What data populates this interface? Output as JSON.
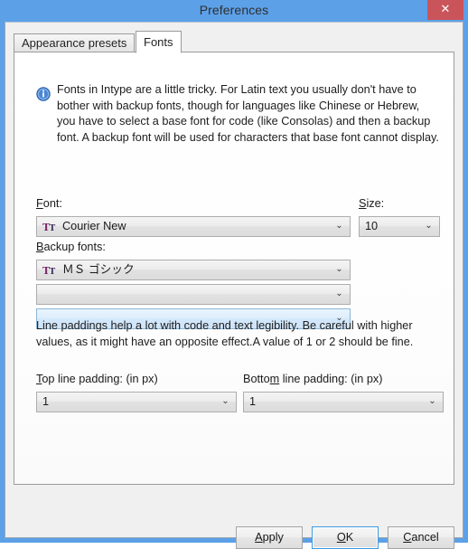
{
  "window": {
    "title": "Preferences",
    "close_label": "✕",
    "accent_color": "#5ca0e8",
    "close_color": "#c9555a"
  },
  "tabs": [
    {
      "label": "Appearance presets",
      "active": false
    },
    {
      "label": "Fonts",
      "active": true
    }
  ],
  "info": {
    "icon": "info-icon",
    "text": "Fonts in Intype are a little tricky. For Latin text you usually don't have to bother with backup fonts, though for languages like Chinese or Hebrew, you have to select a base font for code (like Consolas) and then a backup font. A backup font will be used for characters that base font cannot display."
  },
  "font_section": {
    "font_label_prefix": "F",
    "font_label_rest": "ont:",
    "font_value": "Courier New",
    "font_icon": "truetype-font-icon",
    "size_label_prefix": "S",
    "size_label_rest": "ize:",
    "size_value": "10",
    "backup_label_prefix": "B",
    "backup_label_rest": "ackup fonts:",
    "backup_values": [
      {
        "value": "ＭＳ ゴシック",
        "has_icon": true,
        "focused": false
      },
      {
        "value": "",
        "has_icon": false,
        "focused": false
      },
      {
        "value": "",
        "has_icon": false,
        "focused": true
      }
    ],
    "arrow_glyph": "⌄"
  },
  "padding_section": {
    "hint_text": "Line paddings help a lot with code and text legibility. Be careful with higher values, as it might have an opposite effect.A value of 1 or 2 should be fine.",
    "top_label_prefix": "T",
    "top_label_rest": "op line padding: (in px)",
    "top_value": "1",
    "bottom_label_a": "Botto",
    "bottom_label_accel": "m",
    "bottom_label_b": " line padding: (in px)",
    "bottom_value": "1"
  },
  "buttons": {
    "apply_accel": "A",
    "apply_rest": "pply",
    "ok_accel": "O",
    "ok_rest": "K",
    "cancel_accel": "C",
    "cancel_rest": "ancel"
  }
}
